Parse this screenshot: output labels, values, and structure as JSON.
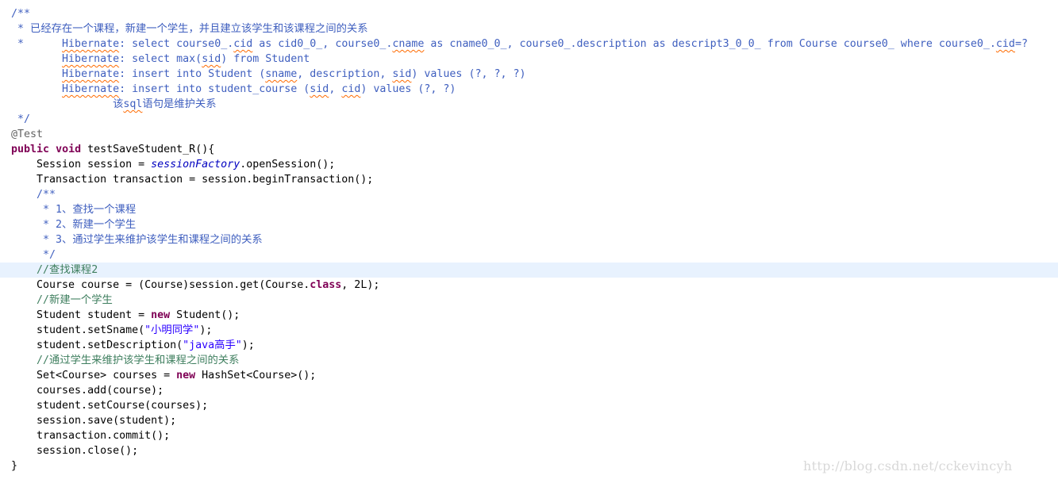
{
  "editor": {
    "highlight_color": "#e8f2fe",
    "current_line": 18,
    "token_colors": {
      "jd": "#3f5fbf",
      "cm": "#3f7f5f",
      "kw": "#7f0055",
      "str": "#2a00ff",
      "ann": "#646464",
      "sf": "#0000c0"
    },
    "lines": [
      [
        [
          "/**",
          "jd"
        ]
      ],
      [
        [
          " * 已经存在一个课程，新建一个学生，并且建立该学生和该课程之间的关系",
          "jd"
        ]
      ],
      [
        [
          " *      ",
          "jd"
        ],
        [
          "Hibernate",
          "jd sp"
        ],
        [
          ": select course0_.",
          "jd"
        ],
        [
          "cid",
          "jd sp"
        ],
        [
          " as cid0_0_, course0_.",
          "jd"
        ],
        [
          "cname",
          "jd sp"
        ],
        [
          " as cname0_0_, course0_.description as descript3_0_0_ from Course course0_ where course0_.",
          "jd"
        ],
        [
          "cid",
          "jd sp"
        ],
        [
          "=?",
          "jd"
        ]
      ],
      [
        [
          "        ",
          "jd"
        ],
        [
          "Hibernate",
          "jd sp"
        ],
        [
          ": select max(",
          "jd"
        ],
        [
          "sid",
          "jd sp"
        ],
        [
          ") from Student",
          "jd"
        ]
      ],
      [
        [
          "        ",
          "jd"
        ],
        [
          "Hibernate",
          "jd sp"
        ],
        [
          ": insert into Student (",
          "jd"
        ],
        [
          "sname",
          "jd sp"
        ],
        [
          ", description, ",
          "jd"
        ],
        [
          "sid",
          "jd sp"
        ],
        [
          ") values (?, ?, ?)",
          "jd"
        ]
      ],
      [
        [
          "        ",
          "jd"
        ],
        [
          "Hibernate",
          "jd sp"
        ],
        [
          ": insert into student_course (",
          "jd"
        ],
        [
          "sid",
          "jd sp"
        ],
        [
          ", ",
          "jd"
        ],
        [
          "cid",
          "jd sp"
        ],
        [
          ") values (?, ?)",
          "jd"
        ]
      ],
      [
        [
          "                该",
          "jd"
        ],
        [
          "sql",
          "jd sp"
        ],
        [
          "语句是维护关系",
          "jd"
        ]
      ],
      [
        [
          " */",
          "jd"
        ]
      ],
      [
        [
          "@Test",
          "ann"
        ]
      ],
      [
        [
          "public",
          "kw"
        ],
        [
          " ",
          ""
        ],
        [
          "void",
          "kw"
        ],
        [
          " testSaveStudent_R(){",
          ""
        ]
      ],
      [
        [
          "    Session session = ",
          ""
        ],
        [
          "sessionFactory",
          "sf"
        ],
        [
          ".openSession();",
          ""
        ]
      ],
      [
        [
          "    Transaction transaction = session.beginTransaction();",
          ""
        ]
      ],
      [
        [
          "    /**",
          "jd"
        ]
      ],
      [
        [
          "     * 1、查找一个课程",
          "jd"
        ]
      ],
      [
        [
          "     * 2、新建一个学生",
          "jd"
        ]
      ],
      [
        [
          "     * 3、通过学生来维护该学生和课程之间的关系",
          "jd"
        ]
      ],
      [
        [
          "     */",
          "jd"
        ]
      ],
      [
        [
          "    //查找课程2",
          "cm"
        ]
      ],
      [
        [
          "    Course course = (Course)session.get(Course.",
          ""
        ],
        [
          "class",
          "kw"
        ],
        [
          ", 2L);",
          ""
        ]
      ],
      [
        [
          "    //新建一个学生",
          "cm"
        ]
      ],
      [
        [
          "    Student student = ",
          ""
        ],
        [
          "new",
          "kw"
        ],
        [
          " Student();",
          ""
        ]
      ],
      [
        [
          "    student.setSname(",
          ""
        ],
        [
          "\"小明同学\"",
          "str"
        ],
        [
          ");",
          ""
        ]
      ],
      [
        [
          "    student.setDescription(",
          ""
        ],
        [
          "\"java高手\"",
          "str"
        ],
        [
          ");",
          ""
        ]
      ],
      [
        [
          "    //通过学生来维护该学生和课程之间的关系",
          "cm"
        ]
      ],
      [
        [
          "    Set<Course> courses = ",
          ""
        ],
        [
          "new",
          "kw"
        ],
        [
          " HashSet<Course>();",
          ""
        ]
      ],
      [
        [
          "    courses.add(course);",
          ""
        ]
      ],
      [
        [
          "    student.setCourse(courses);",
          ""
        ]
      ],
      [
        [
          "    session.save(student);",
          ""
        ]
      ],
      [
        [
          "    transaction.commit();",
          ""
        ]
      ],
      [
        [
          "    session.close();",
          ""
        ]
      ],
      [
        [
          "}",
          ""
        ]
      ]
    ]
  },
  "watermark": "http://blog.csdn.net/cckevincyh"
}
